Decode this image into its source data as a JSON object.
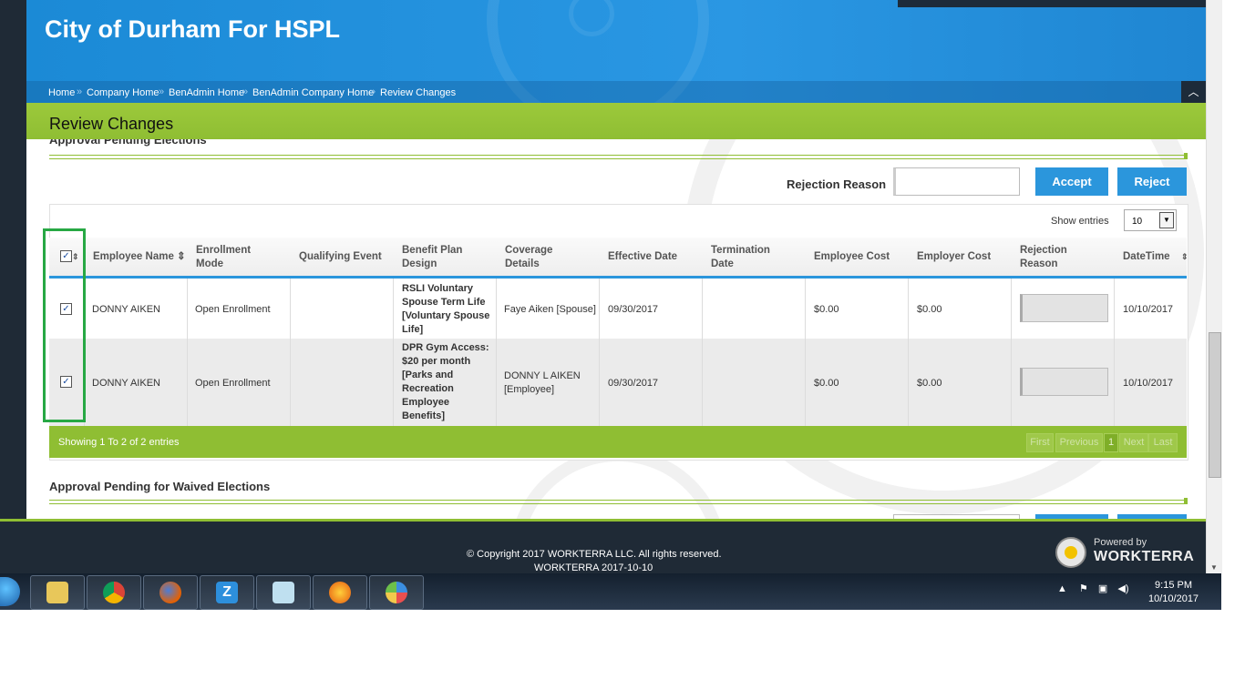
{
  "header": {
    "title": "City of Durham For HSPL",
    "breadcrumb": [
      "Home",
      "Company Home",
      "BenAdmin Home",
      "BenAdmin Company Home",
      "Review Changes"
    ],
    "scroll_top_icon": "chevron-up-icon"
  },
  "page": {
    "title": "Review Changes"
  },
  "section1": {
    "title": "Approval Pending Elections",
    "rejection_label": "Rejection Reason",
    "rejection_value": "",
    "accept_label": "Accept",
    "reject_label": "Reject",
    "show_entries_label": "Show entries",
    "show_entries_value": "10",
    "columns": [
      "Employee Name",
      "Enrollment Mode",
      "Qualifying Event",
      "Benefit Plan Design",
      "Coverage Details",
      "Effective Date",
      "Termination Date",
      "Employee Cost",
      "Employer Cost",
      "Rejection Reason",
      "DateTime"
    ],
    "rows": [
      {
        "checked": true,
        "employee": "DONNY AIKEN",
        "mode": "Open Enrollment",
        "event": "",
        "plan": "RSLI Voluntary Spouse Term Life [Voluntary Spouse Life]",
        "coverage": "Faye Aiken [Spouse]",
        "effective": "09/30/2017",
        "termination": "",
        "emp_cost": "$0.00",
        "er_cost": "$0.00",
        "rejection": "",
        "datetime": "10/10/2017"
      },
      {
        "checked": true,
        "employee": "DONNY AIKEN",
        "mode": "Open Enrollment",
        "event": "",
        "plan": "DPR Gym Access: $20 per month [Parks and Recreation Employee Benefits]",
        "coverage": "DONNY L AIKEN [Employee]",
        "effective": "09/30/2017",
        "termination": "",
        "emp_cost": "$0.00",
        "er_cost": "$0.00",
        "rejection": "",
        "datetime": "10/10/2017"
      }
    ],
    "info": "Showing 1 To 2 of 2 entries",
    "pagination": {
      "first": "First",
      "previous": "Previous",
      "current": "1",
      "next": "Next",
      "last": "Last"
    }
  },
  "section2": {
    "title": "Approval Pending for Waived Elections"
  },
  "footer": {
    "copyright": "© Copyright 2017 WORKTERRA LLC. All rights reserved.",
    "version": "WORKTERRA 2017-10-10",
    "powered_by": "Powered by",
    "brand": "WORKTERRA"
  },
  "taskbar": {
    "apps": [
      "file-explorer-icon",
      "chrome-icon",
      "firefox-icon",
      "z-app-icon",
      "notepad-icon",
      "flame-app-icon",
      "paint-icon"
    ],
    "time": "9:15 PM",
    "date": "10/10/2017"
  }
}
